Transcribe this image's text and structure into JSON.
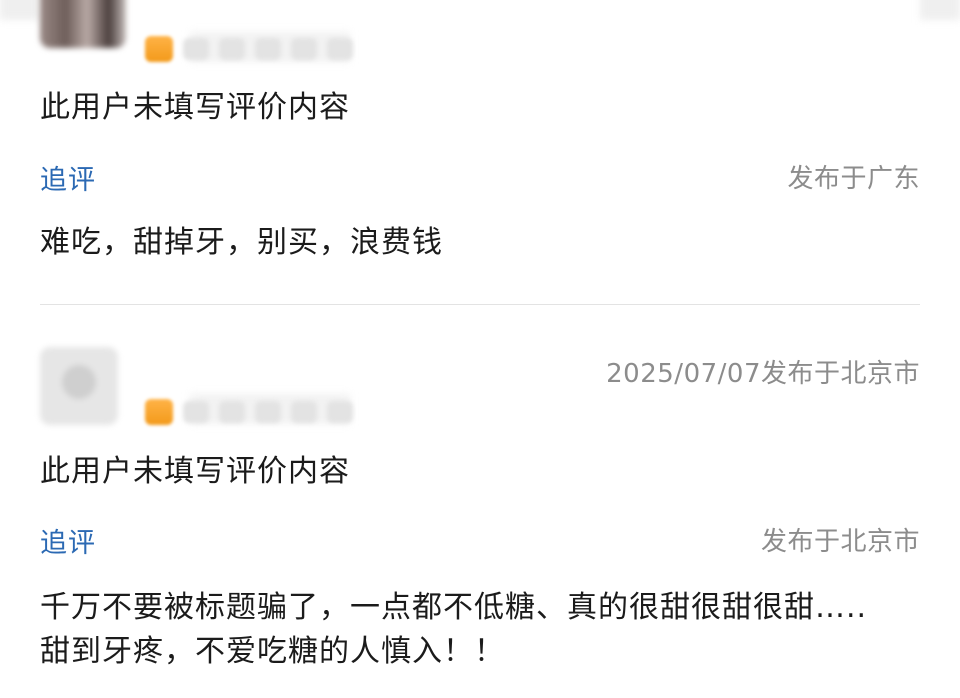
{
  "reviews": [
    {
      "review_text": "此用户未填写评价内容",
      "followup_label": "追评",
      "followup_location": "发布于广东",
      "followup_text": "难吃，甜掉牙，别买，浪费钱"
    },
    {
      "date_location": "2025/07/07发布于北京市",
      "review_text": "此用户未填写评价内容",
      "followup_label": "追评",
      "followup_location": "发布于北京市",
      "followup_text": "千万不要被标题骗了，一点都不低糖、真的很甜很甜很甜….. 甜到牙疼，不爱吃糖的人慎入！！"
    }
  ],
  "colors": {
    "link": "#2b69b3",
    "meta": "#8c8c8c",
    "text": "#1b1b1b"
  }
}
